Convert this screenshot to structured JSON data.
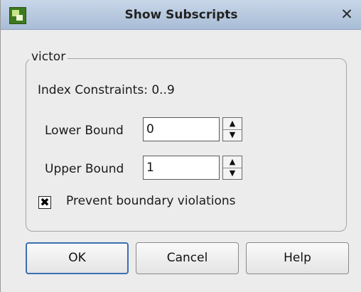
{
  "window": {
    "title": "Show Subscripts",
    "close_glyph": "✕",
    "icon": "app-icon"
  },
  "group": {
    "legend": "victor",
    "index_constraints": "Index Constraints: 0..9"
  },
  "lower": {
    "label": "Lower Bound",
    "value": "0"
  },
  "upper": {
    "label": "Upper Bound",
    "value": "1"
  },
  "spinner": {
    "up_glyph": "▲",
    "down_glyph": "▼"
  },
  "option": {
    "label": "Prevent boundary violations",
    "checked": true,
    "check_glyph": "✖"
  },
  "buttons": {
    "ok": "OK",
    "cancel": "Cancel",
    "help": "Help"
  }
}
